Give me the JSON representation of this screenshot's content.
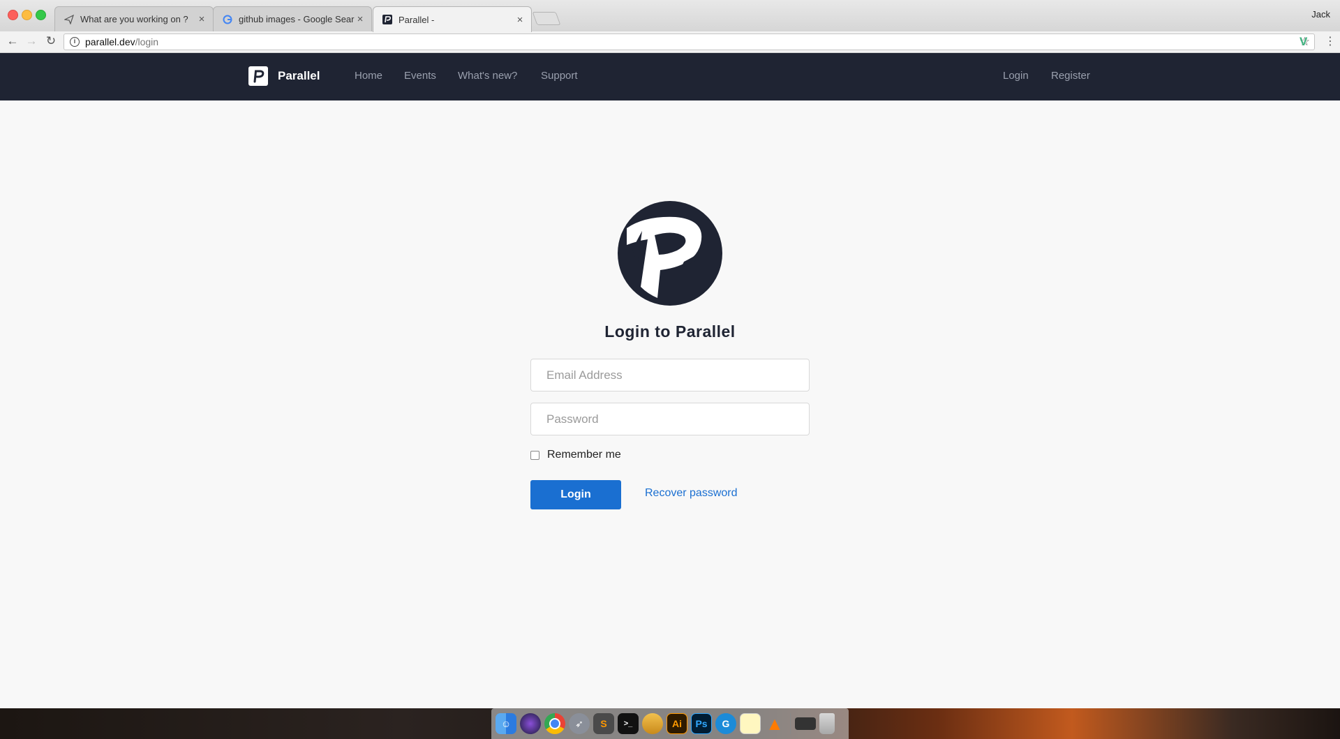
{
  "browser": {
    "tabs": [
      {
        "title": "What are you working on ?",
        "icon": "paper-plane-icon",
        "active": false
      },
      {
        "title": "github images - Google Search",
        "icon": "google-icon",
        "active": false
      },
      {
        "title": "Parallel -",
        "icon": "parallel-icon",
        "active": true
      }
    ],
    "user": "Jack",
    "url_host": "parallel.dev",
    "url_path": "/login"
  },
  "site_nav": {
    "brand": "Parallel",
    "links": [
      "Home",
      "Events",
      "What's new?",
      "Support"
    ],
    "right_links": [
      "Login",
      "Register"
    ]
  },
  "login": {
    "title": "Login to Parallel",
    "email_placeholder": "Email Address",
    "password_placeholder": "Password",
    "remember_label": "Remember me",
    "login_button": "Login",
    "recover_link": "Recover password"
  },
  "colors": {
    "nav_bg": "#1f2433",
    "primary": "#1a6fd1",
    "page_bg": "#f8f8f8"
  },
  "dock": {
    "apps": [
      "finder-icon",
      "siri-icon",
      "chrome-icon",
      "launchpad-icon",
      "sublime-icon",
      "terminal-icon",
      "sequel-pro-icon",
      "illustrator-icon",
      "photoshop-icon",
      "grammarly-icon",
      "notes-icon",
      "vlc-icon",
      "keyboard-icon",
      "trash-icon"
    ],
    "labels": {
      "sublime": "S",
      "terminal": ">_",
      "illustrator": "Ai",
      "photoshop": "Ps",
      "grammarly": "G"
    }
  }
}
